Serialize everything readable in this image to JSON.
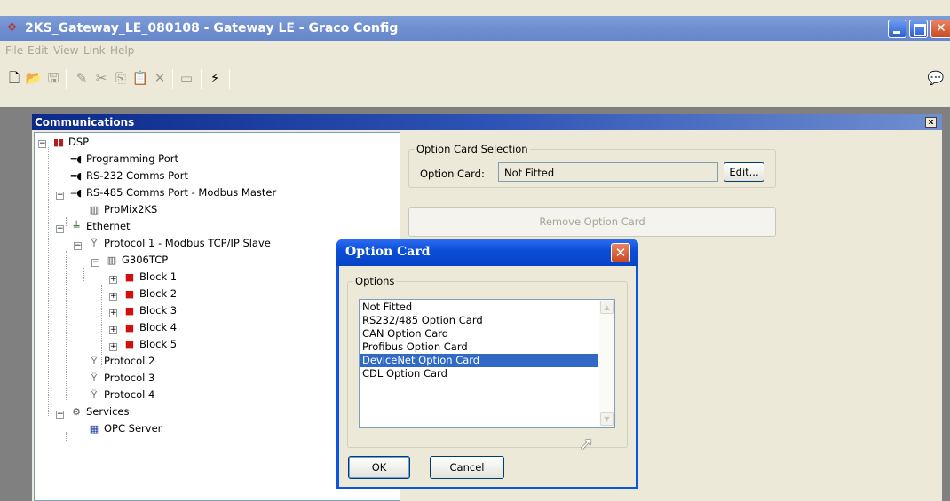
{
  "window": {
    "title": "2KS_Gateway_LE_080108 - Gateway LE - Graco Config"
  },
  "menu": [
    "File",
    "Edit",
    "View",
    "Link",
    "Help"
  ],
  "toolbar": {
    "buttons": [
      "new-icon",
      "open-icon",
      "save-icon",
      "pencil-icon",
      "cut-icon",
      "copy-icon",
      "paste-icon",
      "delete-icon",
      "window-icon",
      "lightning-icon"
    ],
    "right_icon": "comment-icon"
  },
  "comms": {
    "title": "Communications",
    "close_label": "x",
    "tree": {
      "dsp": "DSP",
      "programming_port": "Programming Port",
      "rs232": "RS-232 Comms Port",
      "rs485": "RS-485 Comms Port - Modbus Master",
      "promix": "ProMix2KS",
      "ethernet": "Ethernet",
      "protocol1": "Protocol 1 - Modbus TCP/IP Slave",
      "g306": "G306TCP",
      "blocks": [
        "Block 1",
        "Block 2",
        "Block 3",
        "Block 4",
        "Block 5"
      ],
      "protocol2": "Protocol 2",
      "protocol3": "Protocol 3",
      "protocol4": "Protocol 4",
      "services": "Services",
      "opc": "OPC Server"
    },
    "option_card_selection": {
      "legend": "Option Card Selection",
      "label": "Option Card:",
      "value": "Not Fitted",
      "edit_button": "Edit..."
    },
    "remove_button": "Remove Option Card"
  },
  "dialog": {
    "title": "Option Card",
    "options_legend_prefix": "O",
    "options_legend_rest": "ptions",
    "options": [
      "Not Fitted",
      "RS232/485 Option Card",
      "CAN Option Card",
      "Profibus Option Card",
      "DeviceNet Option Card",
      "CDL Option Card"
    ],
    "selected": "DeviceNet Option Card",
    "ok": "OK",
    "cancel": "Cancel"
  }
}
